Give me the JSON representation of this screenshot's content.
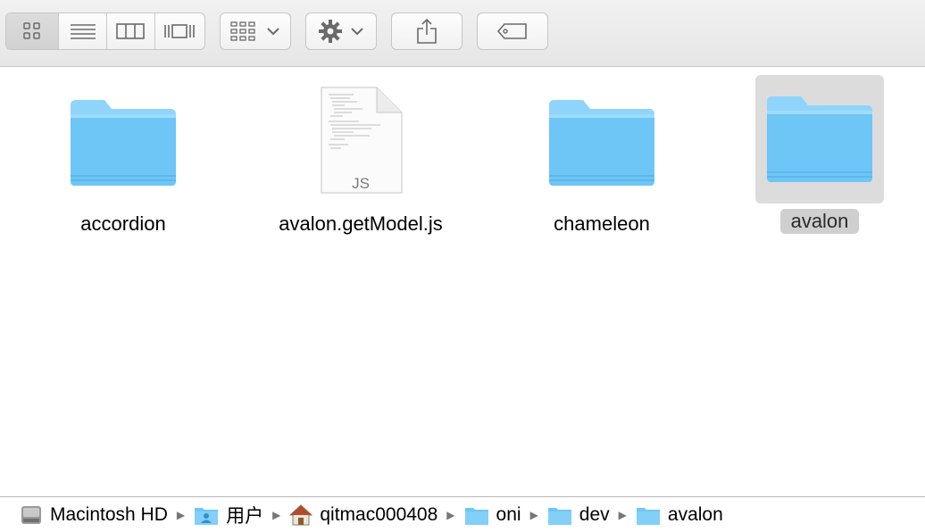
{
  "toolbar": {
    "view_buttons": [
      "icon-view",
      "list-view",
      "column-view",
      "cover-flow-view"
    ],
    "active_view": "icon-view",
    "arrange_icon": "arrange-grid-icon",
    "action_icon": "gear-icon",
    "share_icon": "share-icon",
    "tag_icon": "tag-icon"
  },
  "items": [
    {
      "name": "accordion",
      "type": "folder",
      "selected": false
    },
    {
      "name": "avalon.getModel.js",
      "type": "file",
      "badge": "JS",
      "selected": false
    },
    {
      "name": "chameleon",
      "type": "folder",
      "selected": false
    },
    {
      "name": "avalon",
      "type": "folder",
      "selected": true
    }
  ],
  "path": [
    {
      "label": "Macintosh HD",
      "icon": "hard-drive-icon"
    },
    {
      "label": "用户",
      "icon": "users-folder-icon"
    },
    {
      "label": "qitmac000408",
      "icon": "home-icon"
    },
    {
      "label": "oni",
      "icon": "folder-icon"
    },
    {
      "label": "dev",
      "icon": "folder-icon"
    },
    {
      "label": "avalon",
      "icon": "folder-icon"
    }
  ],
  "colors": {
    "folder_top": "#8fd4fb",
    "folder_body": "#6ec6f7",
    "selection": "#dcdcdc"
  }
}
